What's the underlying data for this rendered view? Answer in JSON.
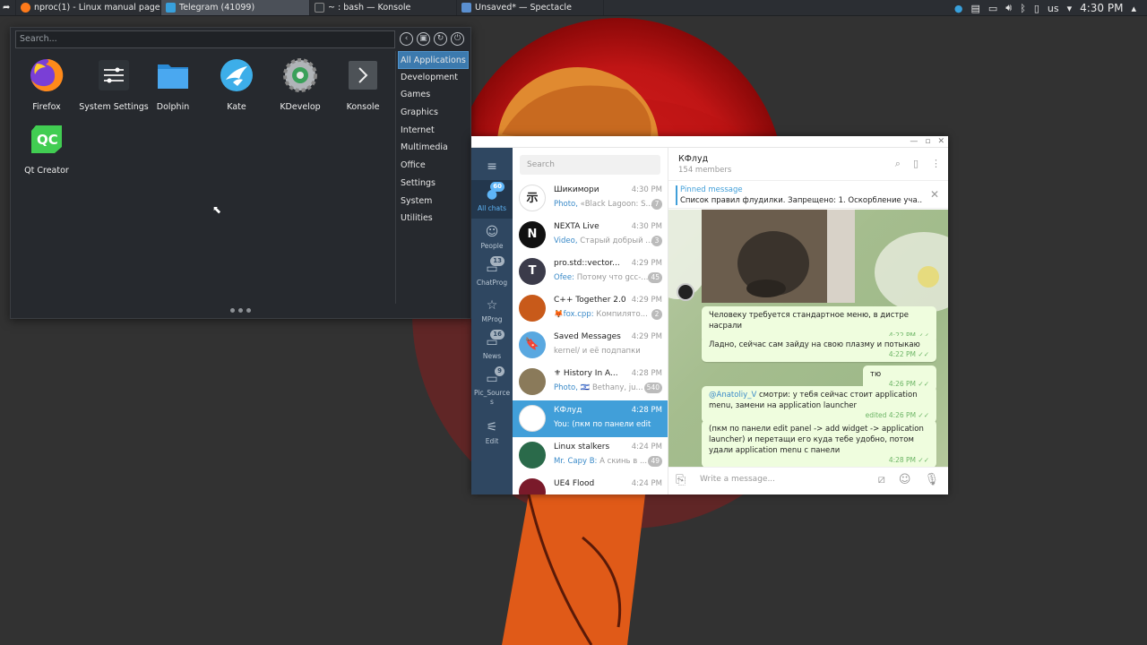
{
  "taskbar": {
    "tasks": [
      {
        "label": "nproc(1) - Linux manual page - M..."
      },
      {
        "label": "Telegram (41099)"
      },
      {
        "label": "~ : bash — Konsole"
      },
      {
        "label": "Unsaved* — Spectacle"
      }
    ],
    "tray": {
      "keyboard_layout": "us",
      "clock": "4:30 PM"
    }
  },
  "launcher": {
    "search_placeholder": "Search...",
    "apps": [
      {
        "label": "Firefox",
        "icon": "firefox-icon"
      },
      {
        "label": "System Settings",
        "icon": "settings-sliders-icon"
      },
      {
        "label": "Dolphin",
        "icon": "folder-icon"
      },
      {
        "label": "Kate",
        "icon": "kate-bird-icon"
      },
      {
        "label": "KDevelop",
        "icon": "kdevelop-gear-icon"
      },
      {
        "label": "Konsole",
        "icon": "terminal-icon"
      },
      {
        "label": "Qt Creator",
        "icon": "qt-icon"
      }
    ],
    "categories": [
      "All Applications",
      "Development",
      "Games",
      "Graphics",
      "Internet",
      "Multimedia",
      "Office",
      "Settings",
      "System",
      "Utilities"
    ]
  },
  "telegram": {
    "search_placeholder": "Search",
    "nav": [
      {
        "label": "All chats",
        "badge": "60"
      },
      {
        "label": "People",
        "badge": ""
      },
      {
        "label": "ChatProg",
        "badge": "13"
      },
      {
        "label": "MProg",
        "badge": ""
      },
      {
        "label": "News",
        "badge": "16"
      },
      {
        "label": "Pic_Source s",
        "badge": "9"
      },
      {
        "label": "Edit",
        "badge": ""
      }
    ],
    "chats": [
      {
        "name": "Шикимори",
        "time": "4:30 PM",
        "sender": "Photo, ",
        "preview": "«Black Lagoon: S...",
        "badge": "7",
        "avatar_color": "#ffffff",
        "avatar_text": "示"
      },
      {
        "name": "NEXTA Live",
        "time": "4:30 PM",
        "sender": "Video, ",
        "preview": "Старый добрый ...",
        "badge": "3",
        "avatar_color": "#111111",
        "avatar_text": "N"
      },
      {
        "name": "pro.std::vector...",
        "time": "4:29 PM",
        "sender": "Ofee: ",
        "preview": "Потому что gcc-...",
        "badge": "45",
        "avatar_color": "#3b3b4a",
        "avatar_text": "T"
      },
      {
        "name": "C++ Together 2.0",
        "time": "4:29 PM",
        "sender": "🦊fox.cpp: ",
        "preview": "Компилято...",
        "badge": "2",
        "avatar_color": "#c85a1a",
        "avatar_text": ""
      },
      {
        "name": "Saved Messages",
        "time": "4:29 PM",
        "sender": "",
        "preview": "kernel/ и её подпапки",
        "badge": "",
        "avatar_color": "#5aa8e0",
        "avatar_text": "🔖"
      },
      {
        "name": "⚜ History In A...",
        "time": "4:28 PM",
        "sender": "Photo, ",
        "preview": "🇮🇱 Bethany, ju...",
        "badge": "540",
        "avatar_color": "#8a7a5a",
        "avatar_text": ""
      },
      {
        "name": "КФлуд",
        "time": "4:28 PM",
        "sender": "",
        "preview": "You: (пкм по панели edit p...",
        "badge": "",
        "avatar_color": "#ffffff",
        "avatar_text": ""
      },
      {
        "name": "Linux stalkers",
        "time": "4:24 PM",
        "sender": "Mr. Capy B: ",
        "preview": "А скинь в ...",
        "badge": "49",
        "avatar_color": "#2a6a4a",
        "avatar_text": ""
      },
      {
        "name": "UE4 Flood",
        "time": "4:24 PM",
        "sender": "",
        "preview": "",
        "badge": "",
        "avatar_color": "#7a1a2a",
        "avatar_text": ""
      }
    ],
    "header": {
      "title": "КФлуд",
      "subtitle": "154 members"
    },
    "pinned": {
      "label": "Pinned message",
      "text": "Список правил флудилки.  Запрещено: 1. Оскорбление уча..."
    },
    "messages": [
      {
        "text": "Человеку требуется стандартное меню, в дистре насрали",
        "meta": "4:22 PM ✓✓"
      },
      {
        "text": "Ладно, сейчас сам зайду на свою плазму и потыкаю",
        "meta": "4:22 PM ✓✓"
      },
      {
        "text": "тю",
        "meta": "4:26 PM ✓✓"
      },
      {
        "mention": "@Anatoliy_V",
        "text": " смотри: у тебя сейчас стоит application menu, замени на application launcher",
        "meta": "edited 4:26 PM ✓✓"
      },
      {
        "text": "(пкм по панели edit panel -> add widget -> application launcher) и перетащи его куда тебе удобно, потом удали application menu с панели",
        "meta": "4:28 PM ✓✓"
      }
    ],
    "compose_placeholder": "Write a message..."
  }
}
